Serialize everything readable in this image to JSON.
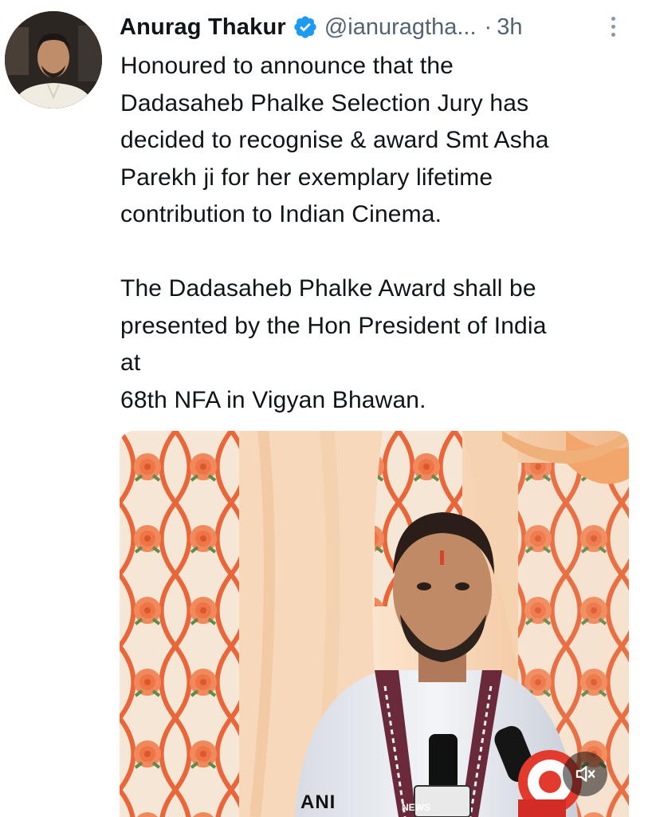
{
  "tweet": {
    "author_name": "Anurag Thakur",
    "handle": "@ianuragtha...",
    "separator": "·",
    "time": "3h",
    "body": [
      "Honoured to announce that the",
      "Dadasaheb Phalke Selection Jury has",
      "decided to recognise & award Smt Asha",
      "Parekh ji for her exemplary lifetime",
      "contribution to Indian Cinema.",
      "",
      "The Dadasaheb Phalke Award shall be",
      "presented by the Hon President of India",
      "at",
      "68th NFA in Vigyan Bhawan."
    ],
    "media": {
      "mic_brand_1": "ANI",
      "mic_brand_2": "NEWS"
    }
  },
  "icons": {
    "verified": "verified-badge-icon",
    "more": "more-vertical-icon",
    "mute": "speaker-muted-icon"
  },
  "colors": {
    "verified_blue": "#1d9bf0",
    "secondary_text": "#536471",
    "primary_text": "#0f1419"
  }
}
